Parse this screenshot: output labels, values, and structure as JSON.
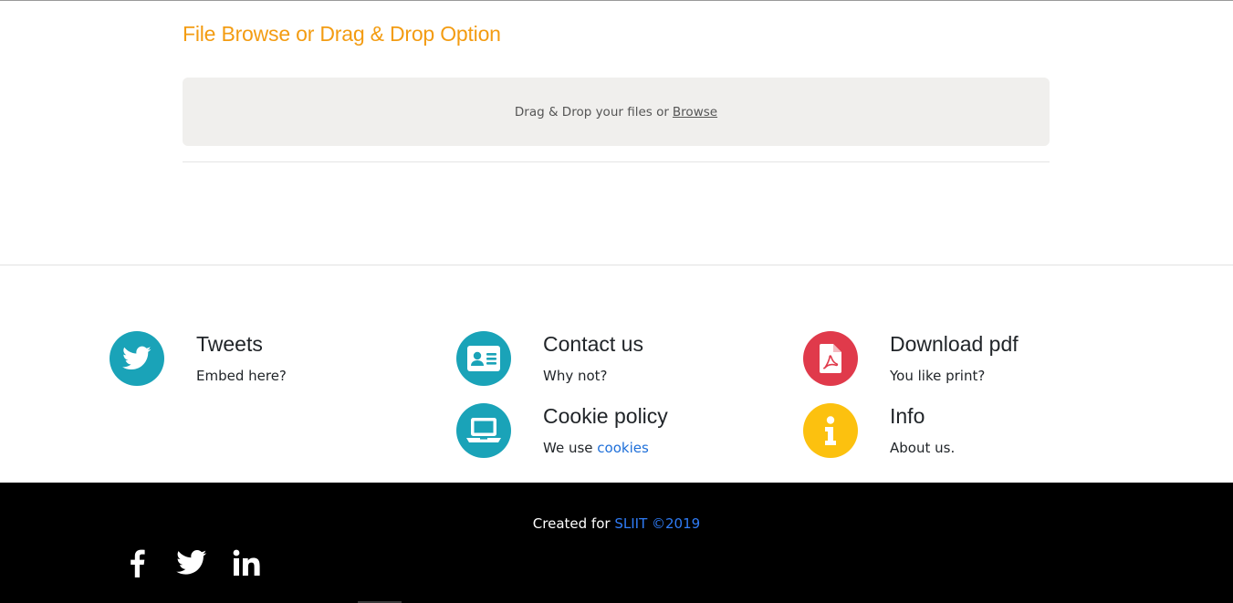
{
  "upload": {
    "title": "File Browse or Drag & Drop Option",
    "prompt": "Drag & Drop your files or",
    "browse_label": "Browse"
  },
  "features": {
    "tweets": {
      "title": "Tweets",
      "text": "Embed here?",
      "icon": "twitter-icon",
      "color": "#1aa3b8"
    },
    "contact": {
      "title": "Contact us",
      "text": "Why not?",
      "icon": "contact-card-icon",
      "color": "#1aa3b8"
    },
    "download": {
      "title": "Download pdf",
      "text": "You like print?",
      "icon": "pdf-file-icon",
      "color": "#e03a4b"
    },
    "cookie": {
      "title": "Cookie policy",
      "text_prefix": "We use",
      "link_label": "cookies",
      "icon": "laptop-icon",
      "color": "#1aa3b8"
    },
    "info": {
      "title": "Info",
      "text": "About us.",
      "icon": "info-icon",
      "color": "#fcc10f"
    }
  },
  "footer": {
    "credit_prefix": "Created for",
    "credit_link": "SLIIT ©2019",
    "social": [
      "facebook-icon",
      "twitter-icon",
      "linkedin-icon"
    ]
  }
}
